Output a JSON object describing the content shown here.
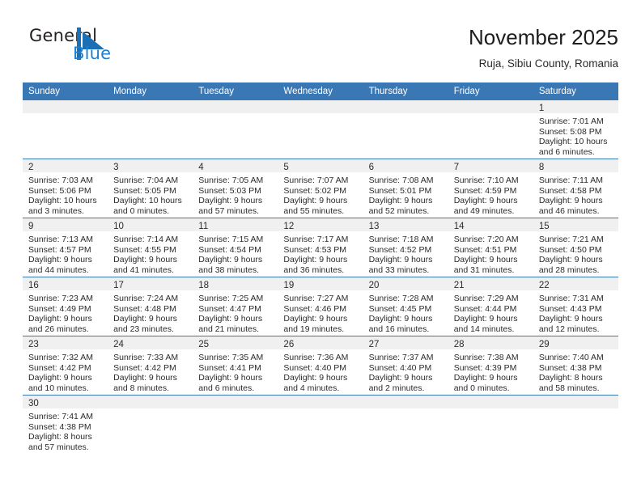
{
  "brand": {
    "name_part1": "General",
    "name_part2": "Blue",
    "logo_icon": "blue-triangle-logo-icon"
  },
  "header": {
    "title": "November 2025",
    "subtitle": "Ruja, Sibiu County, Romania"
  },
  "colors": {
    "header_blue": "#3A78B5",
    "brand_blue": "#1B7FD4",
    "date_band": "#F0F0F0",
    "text": "#2B2B2B"
  },
  "weekday_headers": [
    "Sunday",
    "Monday",
    "Tuesday",
    "Wednesday",
    "Thursday",
    "Friday",
    "Saturday"
  ],
  "labels": {
    "sunrise_prefix": "Sunrise: ",
    "sunset_prefix": "Sunset: ",
    "daylight_prefix": "Daylight: "
  },
  "weeks": [
    [
      {
        "date": "",
        "empty": true
      },
      {
        "date": "",
        "empty": true
      },
      {
        "date": "",
        "empty": true
      },
      {
        "date": "",
        "empty": true
      },
      {
        "date": "",
        "empty": true
      },
      {
        "date": "",
        "empty": true
      },
      {
        "date": "1",
        "sunrise": "Sunrise: 7:01 AM",
        "sunset": "Sunset: 5:08 PM",
        "daylight_line1": "Daylight: 10 hours",
        "daylight_line2": "and 6 minutes."
      }
    ],
    [
      {
        "date": "2",
        "sunrise": "Sunrise: 7:03 AM",
        "sunset": "Sunset: 5:06 PM",
        "daylight_line1": "Daylight: 10 hours",
        "daylight_line2": "and 3 minutes."
      },
      {
        "date": "3",
        "sunrise": "Sunrise: 7:04 AM",
        "sunset": "Sunset: 5:05 PM",
        "daylight_line1": "Daylight: 10 hours",
        "daylight_line2": "and 0 minutes."
      },
      {
        "date": "4",
        "sunrise": "Sunrise: 7:05 AM",
        "sunset": "Sunset: 5:03 PM",
        "daylight_line1": "Daylight: 9 hours",
        "daylight_line2": "and 57 minutes."
      },
      {
        "date": "5",
        "sunrise": "Sunrise: 7:07 AM",
        "sunset": "Sunset: 5:02 PM",
        "daylight_line1": "Daylight: 9 hours",
        "daylight_line2": "and 55 minutes."
      },
      {
        "date": "6",
        "sunrise": "Sunrise: 7:08 AM",
        "sunset": "Sunset: 5:01 PM",
        "daylight_line1": "Daylight: 9 hours",
        "daylight_line2": "and 52 minutes."
      },
      {
        "date": "7",
        "sunrise": "Sunrise: 7:10 AM",
        "sunset": "Sunset: 4:59 PM",
        "daylight_line1": "Daylight: 9 hours",
        "daylight_line2": "and 49 minutes."
      },
      {
        "date": "8",
        "sunrise": "Sunrise: 7:11 AM",
        "sunset": "Sunset: 4:58 PM",
        "daylight_line1": "Daylight: 9 hours",
        "daylight_line2": "and 46 minutes."
      }
    ],
    [
      {
        "date": "9",
        "sunrise": "Sunrise: 7:13 AM",
        "sunset": "Sunset: 4:57 PM",
        "daylight_line1": "Daylight: 9 hours",
        "daylight_line2": "and 44 minutes."
      },
      {
        "date": "10",
        "sunrise": "Sunrise: 7:14 AM",
        "sunset": "Sunset: 4:55 PM",
        "daylight_line1": "Daylight: 9 hours",
        "daylight_line2": "and 41 minutes."
      },
      {
        "date": "11",
        "sunrise": "Sunrise: 7:15 AM",
        "sunset": "Sunset: 4:54 PM",
        "daylight_line1": "Daylight: 9 hours",
        "daylight_line2": "and 38 minutes."
      },
      {
        "date": "12",
        "sunrise": "Sunrise: 7:17 AM",
        "sunset": "Sunset: 4:53 PM",
        "daylight_line1": "Daylight: 9 hours",
        "daylight_line2": "and 36 minutes."
      },
      {
        "date": "13",
        "sunrise": "Sunrise: 7:18 AM",
        "sunset": "Sunset: 4:52 PM",
        "daylight_line1": "Daylight: 9 hours",
        "daylight_line2": "and 33 minutes."
      },
      {
        "date": "14",
        "sunrise": "Sunrise: 7:20 AM",
        "sunset": "Sunset: 4:51 PM",
        "daylight_line1": "Daylight: 9 hours",
        "daylight_line2": "and 31 minutes."
      },
      {
        "date": "15",
        "sunrise": "Sunrise: 7:21 AM",
        "sunset": "Sunset: 4:50 PM",
        "daylight_line1": "Daylight: 9 hours",
        "daylight_line2": "and 28 minutes."
      }
    ],
    [
      {
        "date": "16",
        "sunrise": "Sunrise: 7:23 AM",
        "sunset": "Sunset: 4:49 PM",
        "daylight_line1": "Daylight: 9 hours",
        "daylight_line2": "and 26 minutes."
      },
      {
        "date": "17",
        "sunrise": "Sunrise: 7:24 AM",
        "sunset": "Sunset: 4:48 PM",
        "daylight_line1": "Daylight: 9 hours",
        "daylight_line2": "and 23 minutes."
      },
      {
        "date": "18",
        "sunrise": "Sunrise: 7:25 AM",
        "sunset": "Sunset: 4:47 PM",
        "daylight_line1": "Daylight: 9 hours",
        "daylight_line2": "and 21 minutes."
      },
      {
        "date": "19",
        "sunrise": "Sunrise: 7:27 AM",
        "sunset": "Sunset: 4:46 PM",
        "daylight_line1": "Daylight: 9 hours",
        "daylight_line2": "and 19 minutes."
      },
      {
        "date": "20",
        "sunrise": "Sunrise: 7:28 AM",
        "sunset": "Sunset: 4:45 PM",
        "daylight_line1": "Daylight: 9 hours",
        "daylight_line2": "and 16 minutes."
      },
      {
        "date": "21",
        "sunrise": "Sunrise: 7:29 AM",
        "sunset": "Sunset: 4:44 PM",
        "daylight_line1": "Daylight: 9 hours",
        "daylight_line2": "and 14 minutes."
      },
      {
        "date": "22",
        "sunrise": "Sunrise: 7:31 AM",
        "sunset": "Sunset: 4:43 PM",
        "daylight_line1": "Daylight: 9 hours",
        "daylight_line2": "and 12 minutes."
      }
    ],
    [
      {
        "date": "23",
        "sunrise": "Sunrise: 7:32 AM",
        "sunset": "Sunset: 4:42 PM",
        "daylight_line1": "Daylight: 9 hours",
        "daylight_line2": "and 10 minutes."
      },
      {
        "date": "24",
        "sunrise": "Sunrise: 7:33 AM",
        "sunset": "Sunset: 4:42 PM",
        "daylight_line1": "Daylight: 9 hours",
        "daylight_line2": "and 8 minutes."
      },
      {
        "date": "25",
        "sunrise": "Sunrise: 7:35 AM",
        "sunset": "Sunset: 4:41 PM",
        "daylight_line1": "Daylight: 9 hours",
        "daylight_line2": "and 6 minutes."
      },
      {
        "date": "26",
        "sunrise": "Sunrise: 7:36 AM",
        "sunset": "Sunset: 4:40 PM",
        "daylight_line1": "Daylight: 9 hours",
        "daylight_line2": "and 4 minutes."
      },
      {
        "date": "27",
        "sunrise": "Sunrise: 7:37 AM",
        "sunset": "Sunset: 4:40 PM",
        "daylight_line1": "Daylight: 9 hours",
        "daylight_line2": "and 2 minutes."
      },
      {
        "date": "28",
        "sunrise": "Sunrise: 7:38 AM",
        "sunset": "Sunset: 4:39 PM",
        "daylight_line1": "Daylight: 9 hours",
        "daylight_line2": "and 0 minutes."
      },
      {
        "date": "29",
        "sunrise": "Sunrise: 7:40 AM",
        "sunset": "Sunset: 4:38 PM",
        "daylight_line1": "Daylight: 8 hours",
        "daylight_line2": "and 58 minutes."
      }
    ],
    [
      {
        "date": "30",
        "sunrise": "Sunrise: 7:41 AM",
        "sunset": "Sunset: 4:38 PM",
        "daylight_line1": "Daylight: 8 hours",
        "daylight_line2": "and 57 minutes."
      },
      {
        "date": "",
        "empty": true
      },
      {
        "date": "",
        "empty": true
      },
      {
        "date": "",
        "empty": true
      },
      {
        "date": "",
        "empty": true
      },
      {
        "date": "",
        "empty": true
      },
      {
        "date": "",
        "empty": true
      }
    ]
  ]
}
